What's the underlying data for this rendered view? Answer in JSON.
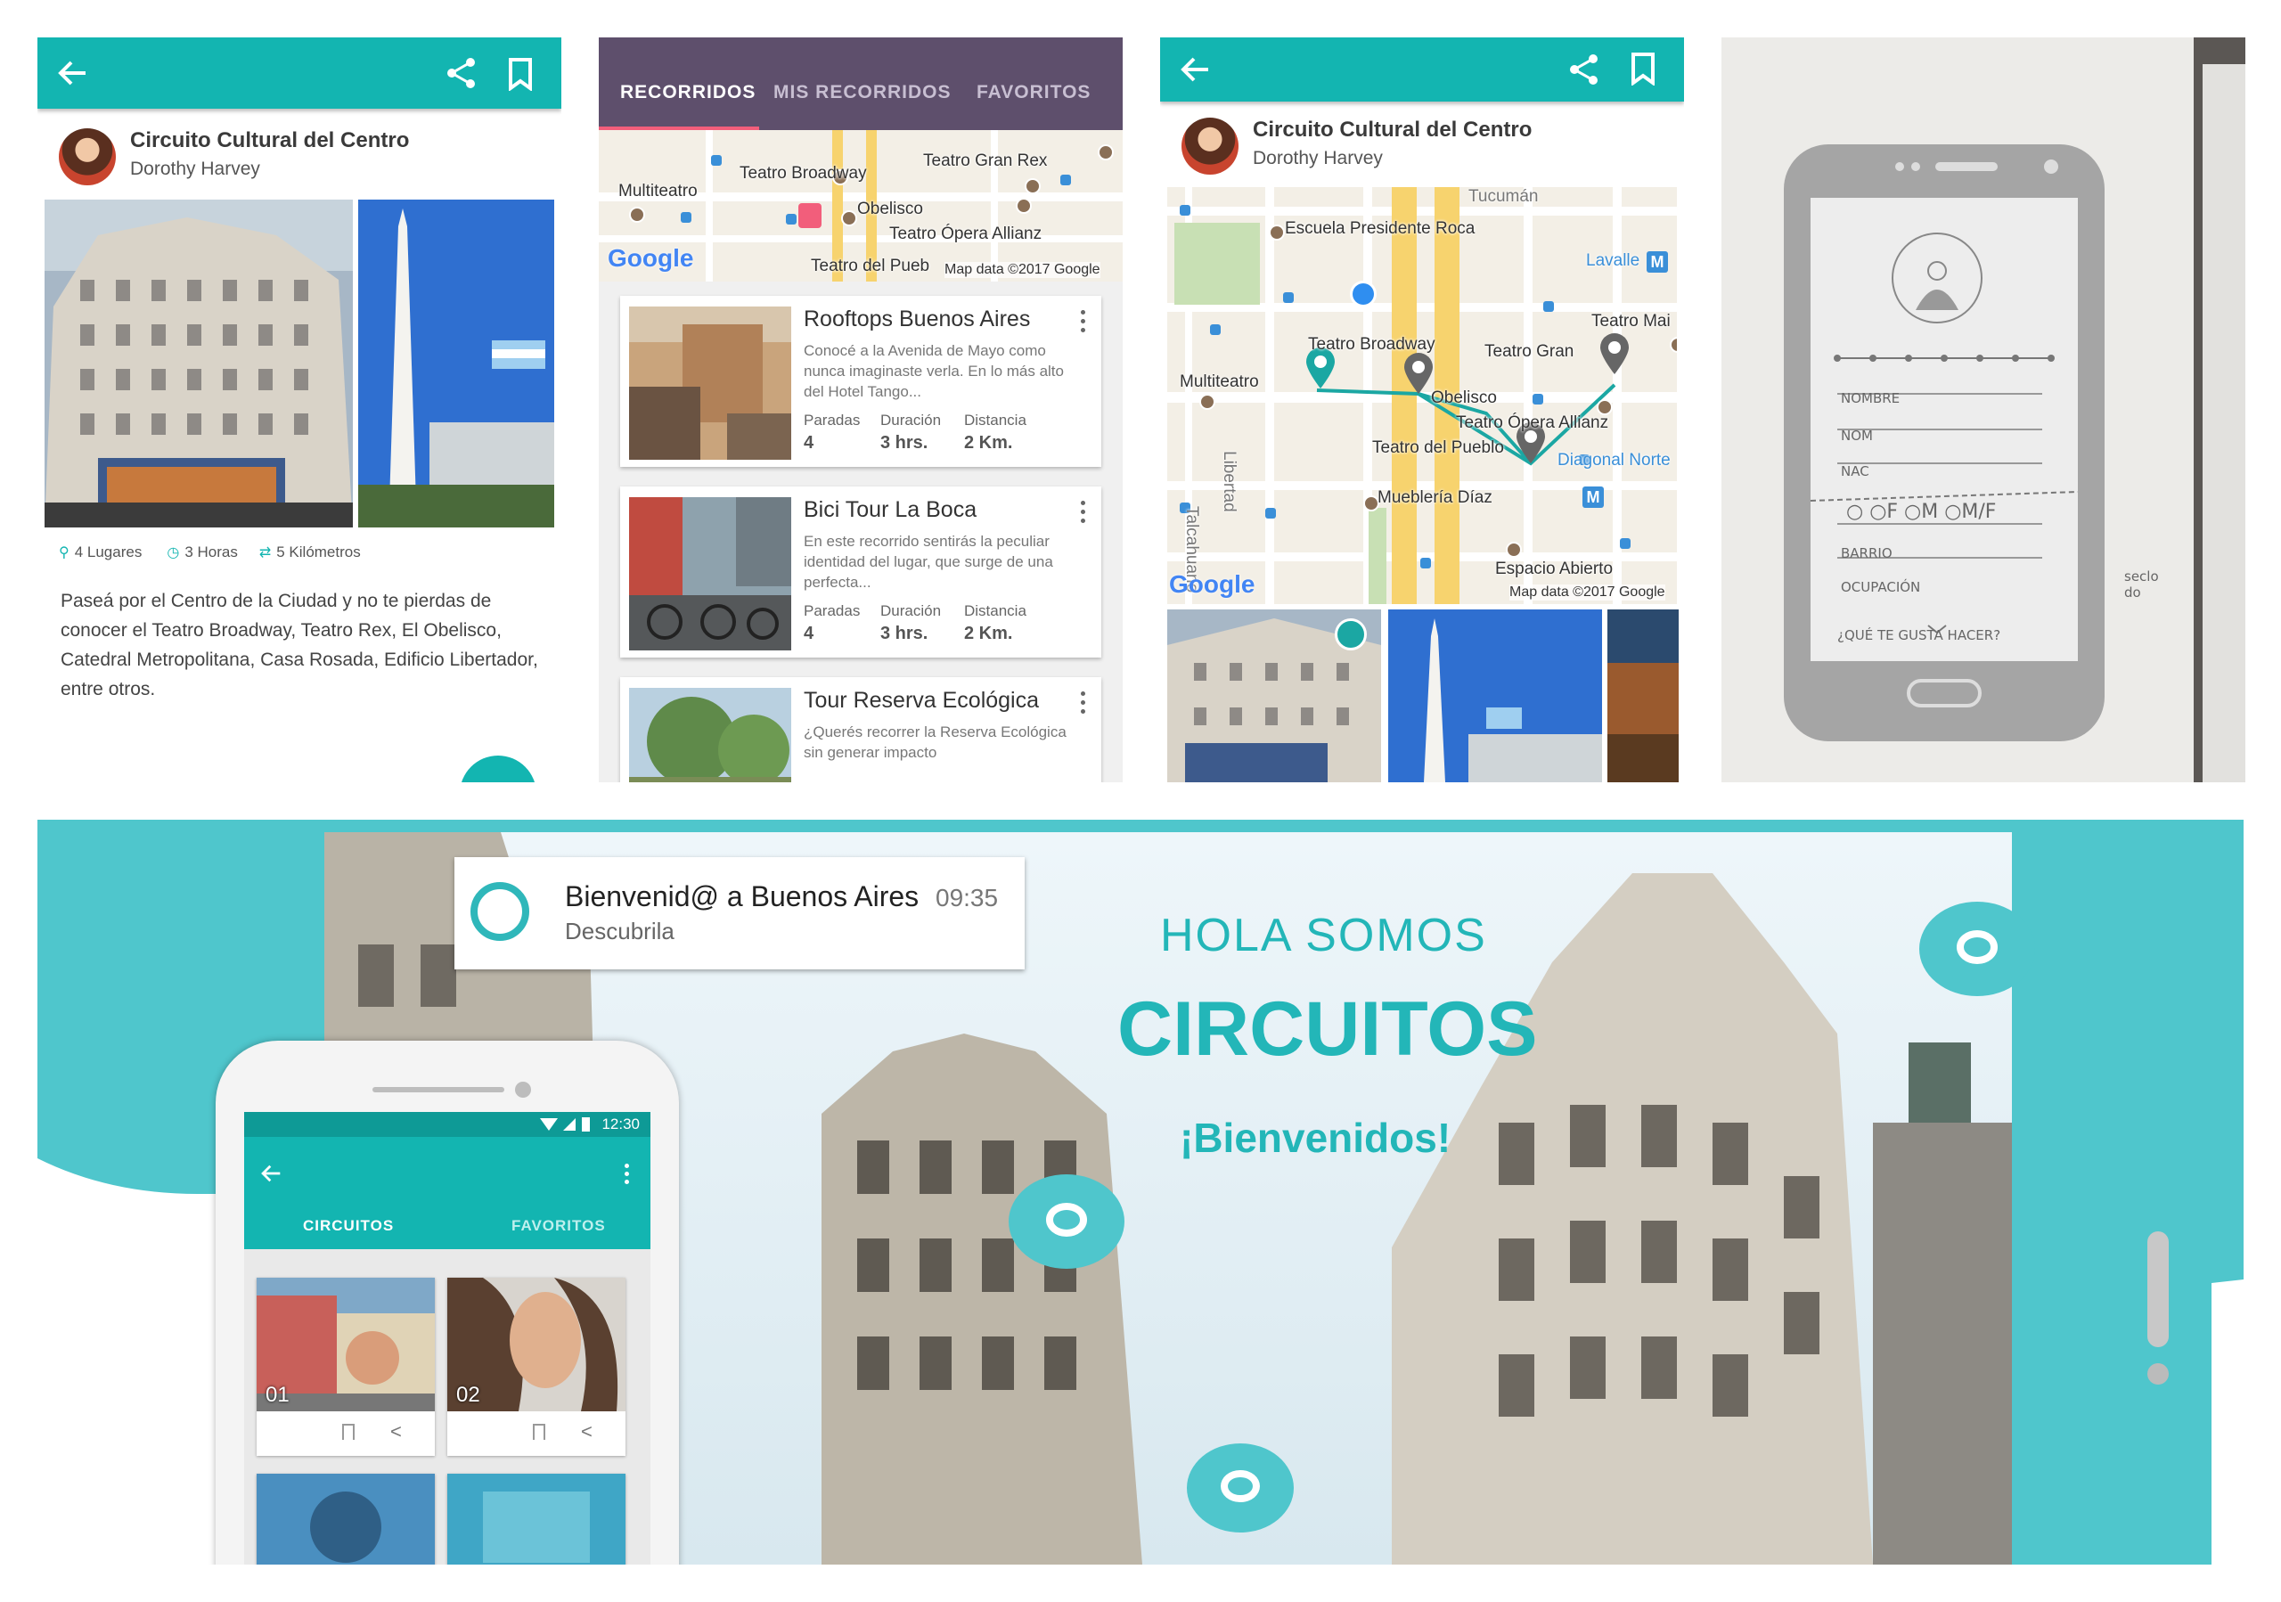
{
  "detail": {
    "title": "Circuito Cultural del Centro",
    "author": "Dorothy Harvey",
    "stats": {
      "places": "4 Lugares",
      "hours": "3 Horas",
      "distance": "5 Kilómetros"
    },
    "description": "Paseá por el Centro de la Ciudad y no te pierdas de conocer el Teatro Broadway, Teatro Rex, El Obelisco, Catedral Metropolitana, Casa Rosada, Edificio Libertador, entre otros.",
    "accent": "#13b5b1"
  },
  "list": {
    "tabs": [
      "RECORRIDOS",
      "MIS RECORRIDOS",
      "FAVORITOS"
    ],
    "tab_color": "#5e4f6c",
    "map_labels": [
      "Teatro Gran Rex",
      "Teatro Broadway",
      "Multiteatro",
      "Obelisco",
      "Teatro Ópera Allianz",
      "Teatro del Pueb"
    ],
    "google": "Google",
    "map_data": "Map data ©2017 Google",
    "stat_labels": {
      "stops": "Paradas",
      "duration": "Duración",
      "distance": "Distancia"
    },
    "tours": [
      {
        "title": "Rooftops Buenos Aires",
        "desc": "Conocé a la Avenida de Mayo como nunca imaginaste verla. En lo más alto del Hotel Tango...",
        "stops": "4",
        "duration": "3 hrs.",
        "distance": "2 Km."
      },
      {
        "title": "Bici Tour La Boca",
        "desc": "En este recorrido sentirás la peculiar identidad del lugar, que surge de una perfecta...",
        "stops": "4",
        "duration": "3 hrs.",
        "distance": "2 Km."
      },
      {
        "title": "Tour Reserva Ecológica",
        "desc": "¿Querés recorrer la Reserva Ecológica sin generar impacto"
      }
    ]
  },
  "route": {
    "title": "Circuito Cultural del Centro",
    "author": "Dorothy Harvey",
    "map_labels": [
      "Tucumán",
      "Escuela Presidente Roca",
      "Lavalle",
      "Teatro Broadway",
      "Teatro Gran",
      "Teatro Mai",
      "Multiteatro",
      "Obelisco",
      "Teatro Ópera Allianz",
      "Teatro del Pueblo",
      "Diagonal Norte",
      "Libertad",
      "Mueblería Díaz",
      "Talcahuano",
      "Espacio Abierto"
    ],
    "google": "Google",
    "map_data": "Map data ©2017 Google"
  },
  "sketch": {
    "labels": [
      "NOMBRE",
      "NOM",
      "NAC",
      "○ ○F ○M ○M/F",
      "BARRIO",
      "OCUPACIÓN",
      "¿QUÉ TE GUSTA HACER?",
      "seclo do"
    ]
  },
  "banner": {
    "notif_title": "Bienvenid@ a Buenos Aires",
    "notif_time": "09:35",
    "notif_sub": "Descubrila",
    "hero_line1": "HOLA SOMOS",
    "hero_line2": "CIRCUITOS",
    "hero_line3": "¡Bienvenidos!",
    "phone_time": "12:30",
    "phone_tabs": [
      "CIRCUITOS",
      "FAVORITOS"
    ],
    "tile_numbers": [
      "01",
      "02"
    ],
    "accent": "#4fc6cc"
  }
}
